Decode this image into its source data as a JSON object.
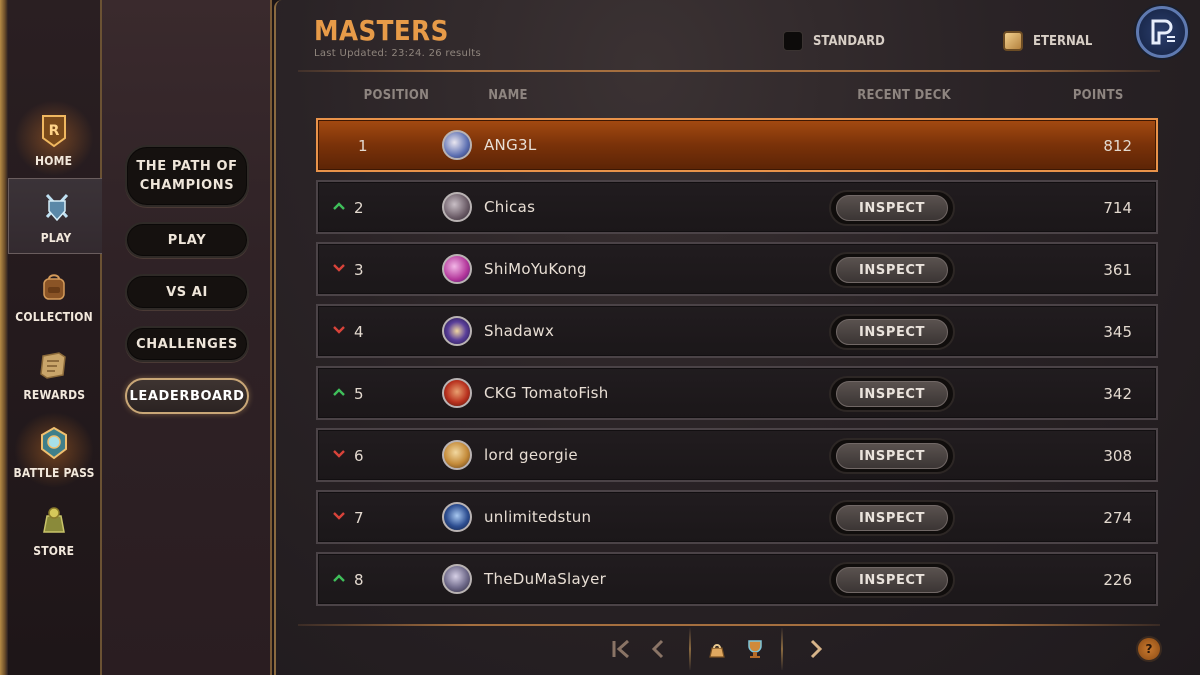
{
  "nav": {
    "items": [
      {
        "label": "HOME",
        "icon": "home-emblem-icon"
      },
      {
        "label": "PLAY",
        "icon": "crossed-swords-shield-icon"
      },
      {
        "label": "COLLECTION",
        "icon": "backpack-icon"
      },
      {
        "label": "REWARDS",
        "icon": "scroll-map-icon"
      },
      {
        "label": "BATTLE PASS",
        "icon": "pass-badge-icon"
      },
      {
        "label": "STORE",
        "icon": "coin-bag-icon"
      }
    ]
  },
  "submenu": {
    "path_of_champions": "THE PATH OF CHAMPIONS",
    "play": "PLAY",
    "vs_ai": "VS AI",
    "challenges": "CHALLENGES",
    "leaderboard": "LEADERBOARD"
  },
  "header": {
    "title": "MASTERS",
    "subtitle": "Last Updated: 23:24. 26 results",
    "filter_standard": "STANDARD",
    "filter_eternal": "ETERNAL"
  },
  "columns": {
    "position": "POSITION",
    "name": "NAME",
    "recent_deck": "RECENT DECK",
    "points": "POINTS"
  },
  "inspect_label": "INSPECT",
  "rows": [
    {
      "position": "1",
      "name": "ANG3L",
      "points": "812",
      "trend": "none",
      "avatar": "#5c6fb2"
    },
    {
      "position": "2",
      "name": "Chicas",
      "points": "714",
      "trend": "up",
      "avatar": "#6a5b66"
    },
    {
      "position": "3",
      "name": "ShiMoYuKong",
      "points": "361",
      "trend": "down",
      "avatar": "#b2359a"
    },
    {
      "position": "4",
      "name": "Shadawx",
      "points": "345",
      "trend": "down",
      "avatar": "#5a3f9a"
    },
    {
      "position": "5",
      "name": "CKG TomatoFish",
      "points": "342",
      "trend": "up",
      "avatar": "#b9321f"
    },
    {
      "position": "6",
      "name": "lord georgie",
      "points": "308",
      "trend": "down",
      "avatar": "#c48b3a"
    },
    {
      "position": "7",
      "name": "unlimitedstun",
      "points": "274",
      "trend": "down",
      "avatar": "#2e4f92"
    },
    {
      "position": "8",
      "name": "TheDuMaSlayer",
      "points": "226",
      "trend": "up",
      "avatar": "#6f6a8a"
    }
  ],
  "colors": {
    "accent_orange": "#e79b48",
    "trend_up": "#3fbf5a",
    "trend_down": "#d8433a",
    "highlight_row": "#a44a11"
  }
}
